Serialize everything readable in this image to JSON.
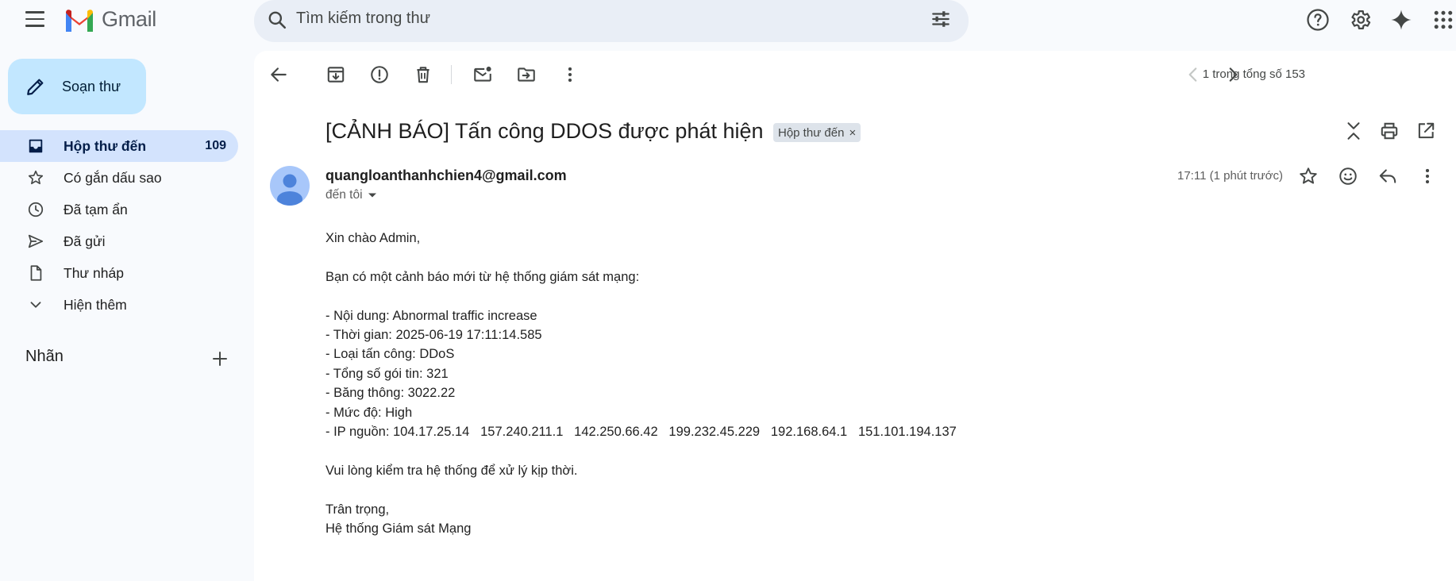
{
  "app": {
    "name": "Gmail"
  },
  "search": {
    "placeholder": "Tìm kiếm trong thư"
  },
  "sidebar": {
    "compose_label": "Soạn thư",
    "items": [
      {
        "label": "Hộp thư đến",
        "count": "109",
        "icon": "inbox-icon"
      },
      {
        "label": "Có gắn dấu sao",
        "count": "",
        "icon": "star-icon"
      },
      {
        "label": "Đã tạm ẩn",
        "count": "",
        "icon": "clock-icon"
      },
      {
        "label": "Đã gửi",
        "count": "",
        "icon": "send-icon"
      },
      {
        "label": "Thư nháp",
        "count": "",
        "icon": "draft-icon"
      },
      {
        "label": "Hiện thêm",
        "count": "",
        "icon": "chevron-down-icon"
      }
    ],
    "labels_heading": "Nhãn"
  },
  "toolbar": {
    "pager": "1 trong tổng số 153"
  },
  "email": {
    "subject": "[CẢNH BÁO] Tấn công DDOS được phát hiện",
    "label_chip": "Hộp thư đến",
    "chip_close": "×",
    "sender": "quangloanthanhchien4@gmail.com",
    "recipient": "đến tôi",
    "time": "17:11 (1 phút trước)",
    "body_lines": [
      "Xin chào Admin,",
      "",
      "Bạn có một cảnh báo mới từ hệ thống giám sát mạng:",
      "",
      "- Nội dung: Abnormal traffic increase",
      "- Thời gian: 2025-06-19 17:11:14.585",
      "- Loại tấn công: DDoS",
      "- Tổng số gói tin: 321",
      "- Băng thông: 3022.22",
      "- Mức độ: High",
      "- IP nguồn: 104.17.25.14   157.240.211.1   142.250.66.42   199.232.45.229   192.168.64.1   151.101.194.137",
      "",
      "Vui lòng kiểm tra hệ thống để xử lý kịp thời.",
      "",
      "Trân trọng,",
      "Hệ thống Giám sát Mạng"
    ]
  },
  "colors": {
    "background": "#f8fafd",
    "search_bg": "#e9eef6",
    "compose_bg": "#c2e7ff",
    "active_nav_bg": "#d3e3fd",
    "chip_bg": "#dde3ea"
  }
}
